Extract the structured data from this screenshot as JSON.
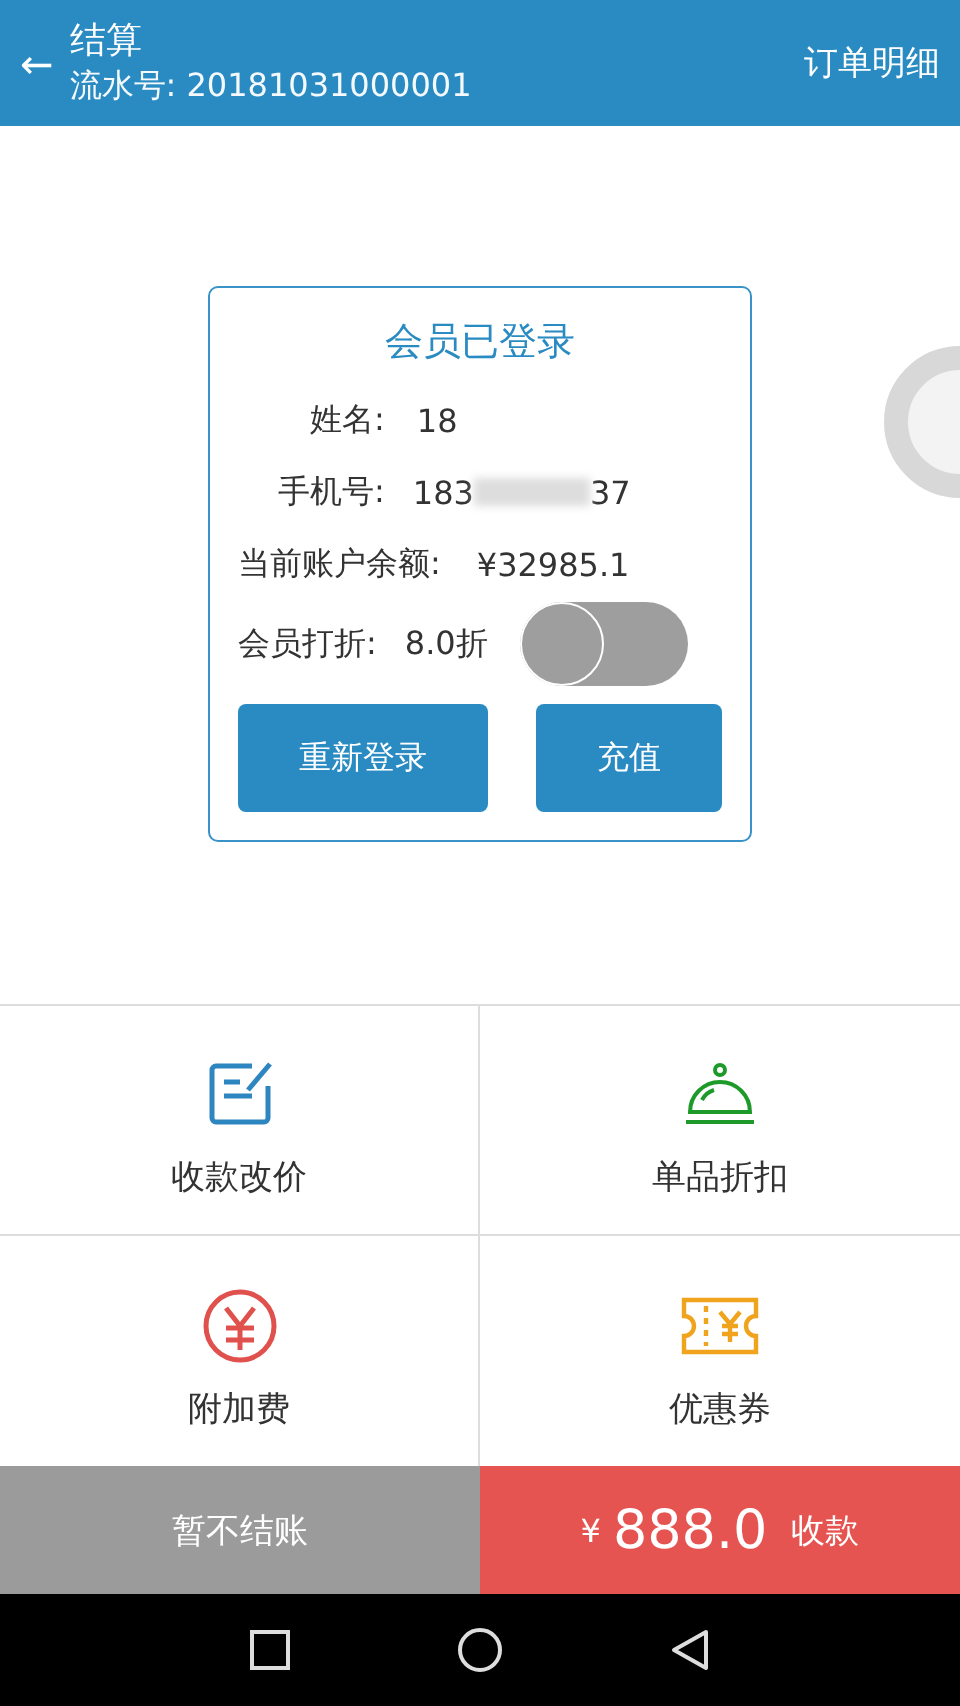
{
  "header": {
    "back": "←",
    "title": "结算",
    "serial_label": "流水号:",
    "serial": "20181031000001",
    "action": "订单明细"
  },
  "member_card": {
    "title": "会员已登录",
    "fields": [
      {
        "kind": "text",
        "label": "姓名:",
        "value": "18"
      },
      {
        "kind": "masked",
        "label": "手机号:",
        "start": "183",
        "end": "37"
      },
      {
        "kind": "text",
        "label": "当前账户余额:",
        "value": "¥32985.1"
      },
      {
        "kind": "switch",
        "label": "会员打折:",
        "value": "8.0折",
        "on": false
      }
    ],
    "buttons": [
      "重新登录",
      "充值"
    ]
  },
  "functions": [
    {
      "kind": "edit",
      "label": "收款改价",
      "color": "#2e86c1"
    },
    {
      "kind": "dish",
      "label": "单品折扣",
      "color": "#1e9a2a"
    },
    {
      "kind": "yuan",
      "label": "附加费",
      "color": "#e0514d"
    },
    {
      "kind": "coupon",
      "label": "优惠券",
      "color": "#f0a31c"
    }
  ],
  "footer": {
    "hold": "暂不结账",
    "currency": "¥",
    "amount": "888.0",
    "pay": "收款"
  }
}
